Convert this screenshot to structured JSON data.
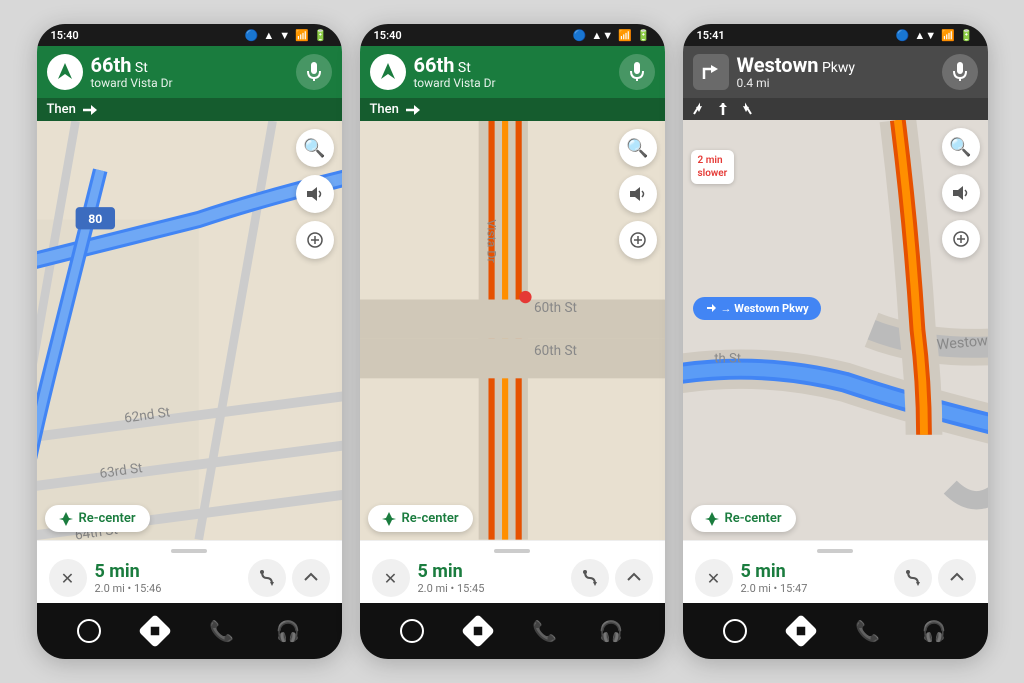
{
  "phones": [
    {
      "id": "phone1",
      "status_time": "15:40",
      "header_type": "green",
      "header_street": "66th",
      "header_street_suffix": " St",
      "header_toward": "toward Vista Dr",
      "then_text": "Then",
      "then_arrow": "→",
      "map_type": "map1",
      "trip_time": "5 min",
      "trip_distance": "2.0 mi",
      "trip_eta": "15:46",
      "distance_label": null,
      "turn_indicators": null,
      "traffic_badge": null,
      "westown_badge": null
    },
    {
      "id": "phone2",
      "status_time": "15:40",
      "header_type": "green",
      "header_street": "66th",
      "header_street_suffix": " St",
      "header_toward": "toward Vista Dr",
      "then_text": "Then",
      "then_arrow": "→",
      "map_type": "map2",
      "trip_time": "5 min",
      "trip_distance": "2.0 mi",
      "trip_eta": "15:45",
      "distance_label": null,
      "turn_indicators": null,
      "traffic_badge": null,
      "westown_badge": null
    },
    {
      "id": "phone3",
      "status_time": "15:41",
      "header_type": "gray",
      "header_street": "Westown",
      "header_street_suffix": " Pkwy",
      "header_toward": "0.4 mi",
      "then_text": null,
      "then_arrow": null,
      "map_type": "map3",
      "trip_time": "5 min",
      "trip_distance": "2.0 mi",
      "trip_eta": "15:47",
      "distance_label": "0.4 mi",
      "turn_indicators": [
        "↱",
        "↑",
        "↱"
      ],
      "traffic_badge": "2 min\nslower",
      "westown_badge": "→ Westown Pkwy"
    }
  ],
  "labels": {
    "recenter": "Re-center",
    "search_icon": "🔍",
    "volume_icon": "🔊",
    "add_icon": "⊕",
    "close_icon": "✕",
    "mic_icon": "🎤"
  }
}
